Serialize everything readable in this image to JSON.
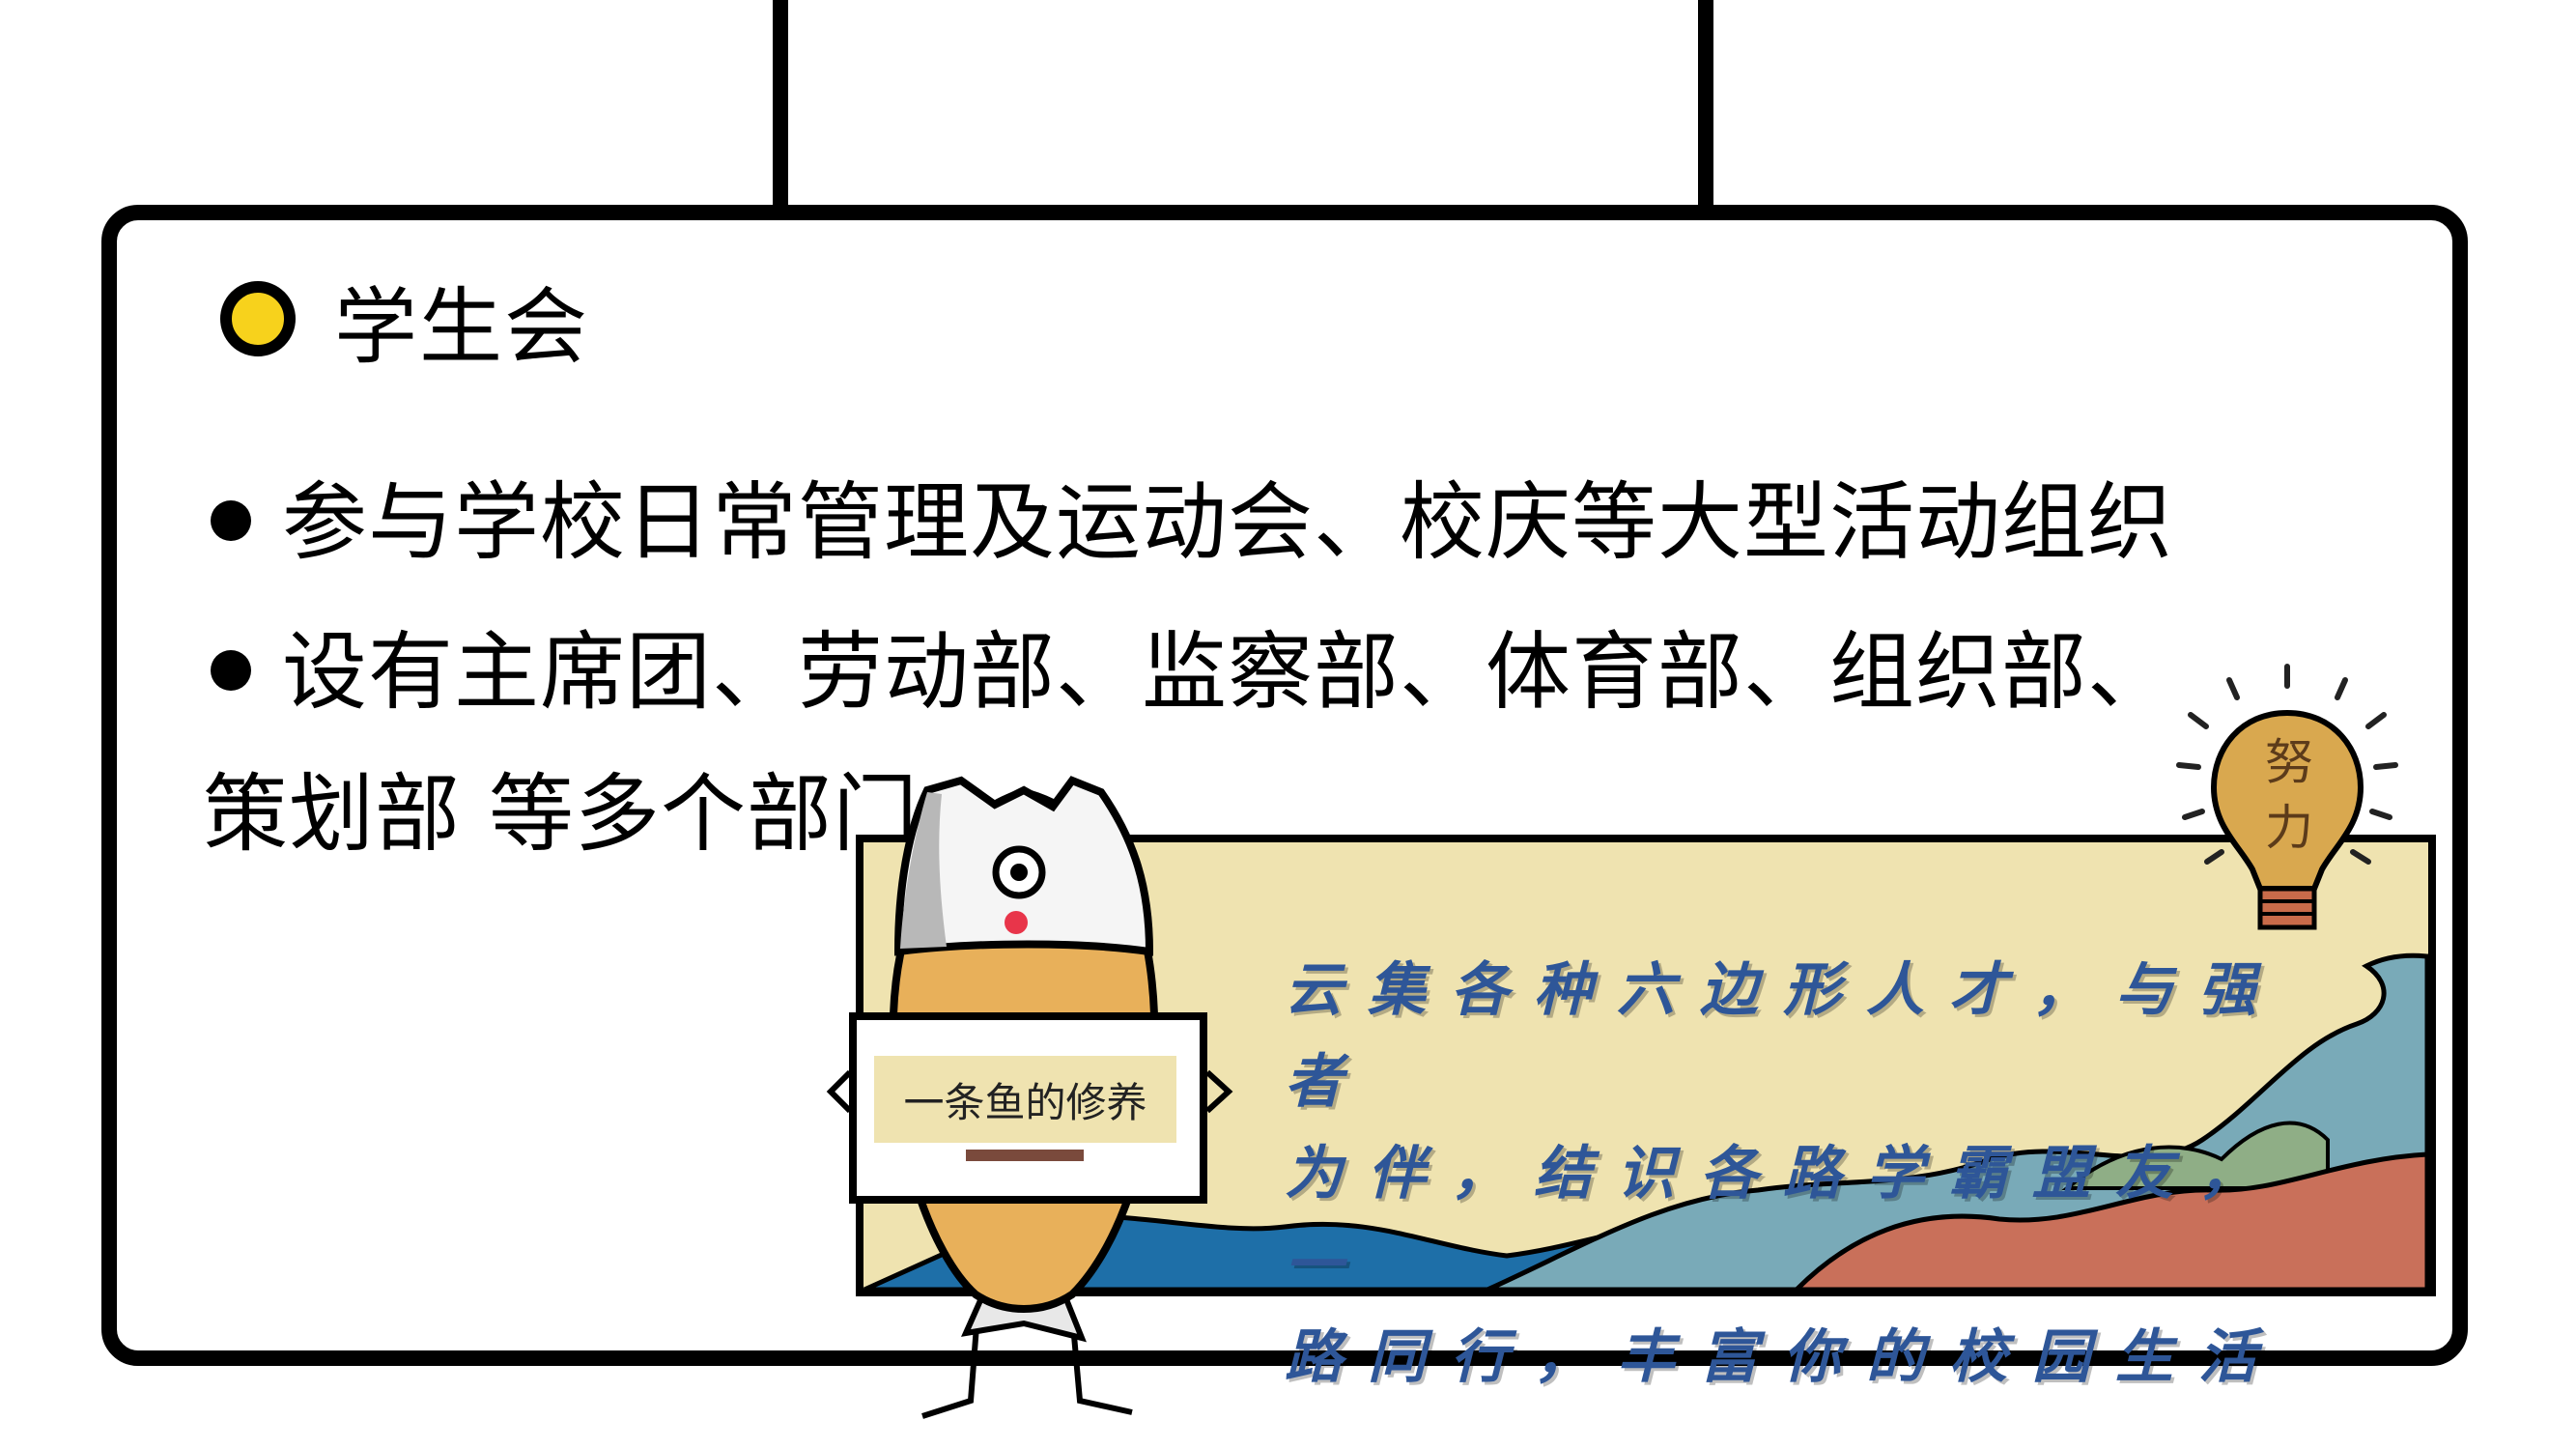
{
  "heading": {
    "title": "学生会",
    "dot_color": "#f7d21c"
  },
  "bullets": [
    "参与学校日常管理及运动会、校庆等大型活动组织",
    "设有主席团、劳动部、监察部、体育部、组织部、",
    "策划部 等多个部门"
  ],
  "illustration": {
    "sign_text": "一条鱼的修养",
    "bulb_text": "努力",
    "slogan_lines": [
      "云集各种六边形人才，与强者",
      "为伴，结识各路学霸盟友，一",
      "路同行，丰富你的校园生活"
    ],
    "colors": {
      "panel": "#efe3b0",
      "sea_blue": "#1e6fa8",
      "sea_teal": "#79aab8",
      "hill_red": "#c9705a",
      "hill_green": "#8fae86",
      "fish_body": "#e8b05a",
      "bulb": "#d9a84f",
      "slogan": "#2e5698"
    }
  }
}
